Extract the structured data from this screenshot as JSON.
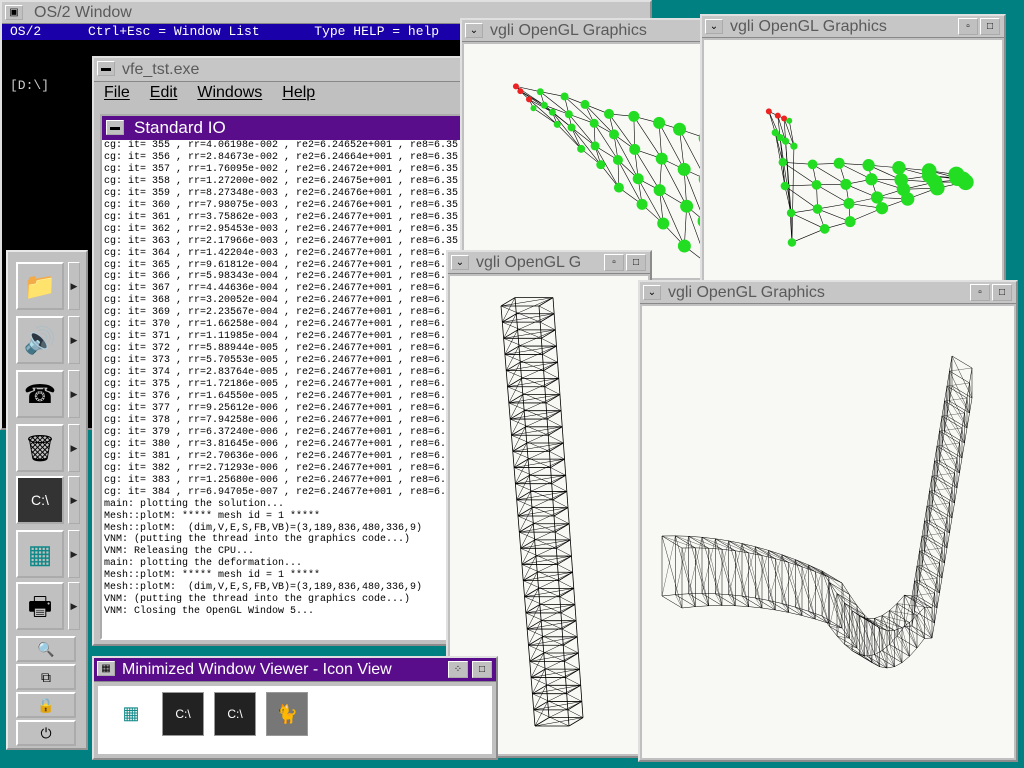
{
  "os2_window": {
    "title": "OS/2 Window",
    "status_left": "OS/2",
    "status_mid": "Ctrl+Esc = Window List",
    "status_right": "Type HELP = help",
    "prompt": "[D:\\]"
  },
  "vfe_window": {
    "title": "vfe_tst.exe",
    "menu": [
      "File",
      "Edit",
      "Windows",
      "Help"
    ],
    "stdio_title": "Standard IO",
    "lines": [
      "cg: it= 355 , rr=4.06198e-002 , re2=6.24652e+001 , re8=6.35!",
      "cg: it= 356 , rr=2.84673e-002 , re2=6.24664e+001 , re8=6.35!",
      "cg: it= 357 , rr=1.76095e-002 , re2=6.24672e+001 , re8=6.35!",
      "cg: it= 358 , rr=1.27200e-002 , re2=6.24675e+001 , re8=6.35!",
      "cg: it= 359 , rr=8.27348e-003 , re2=6.24676e+001 , re8=6.35!",
      "cg: it= 360 , rr=7.98075e-003 , re2=6.24676e+001 , re8=6.35!",
      "cg: it= 361 , rr=3.75862e-003 , re2=6.24677e+001 , re8=6.35!",
      "cg: it= 362 , rr=2.95453e-003 , re2=6.24677e+001 , re8=6.35!",
      "cg: it= 363 , rr=2.17966e-003 , re2=6.24677e+001 , re8=6.35!",
      "cg: it= 364 , rr=1.42204e-003 , re2=6.24677e+001 , re8=6.",
      "cg: it= 365 , rr=9.61812e-004 , re2=6.24677e+001 , re8=6.",
      "cg: it= 366 , rr=5.98343e-004 , re2=6.24677e+001 , re8=6.",
      "cg: it= 367 , rr=4.44636e-004 , re2=6.24677e+001 , re8=6.",
      "cg: it= 368 , rr=3.20052e-004 , re2=6.24677e+001 , re8=6.",
      "cg: it= 369 , rr=2.23567e-004 , re2=6.24677e+001 , re8=6.",
      "cg: it= 370 , rr=1.66258e-004 , re2=6.24677e+001 , re8=6.",
      "cg: it= 371 , rr=1.11985e-004 , re2=6.24677e+001 , re8=6.",
      "cg: it= 372 , rr=5.88944e-005 , re2=6.24677e+001 , re8=6.",
      "cg: it= 373 , rr=5.70553e-005 , re2=6.24677e+001 , re8=6.",
      "cg: it= 374 , rr=2.83764e-005 , re2=6.24677e+001 , re8=6.",
      "cg: it= 375 , rr=1.72186e-005 , re2=6.24677e+001 , re8=6.",
      "cg: it= 376 , rr=1.64550e-005 , re2=6.24677e+001 , re8=6.",
      "cg: it= 377 , rr=9.25612e-006 , re2=6.24677e+001 , re8=6.",
      "cg: it= 378 , rr=7.94258e-006 , re2=6.24677e+001 , re8=6.",
      "cg: it= 379 , rr=6.37240e-006 , re2=6.24677e+001 , re8=6.",
      "cg: it= 380 , rr=3.81645e-006 , re2=6.24677e+001 , re8=6.",
      "cg: it= 381 , rr=2.70636e-006 , re2=6.24677e+001 , re8=6.",
      "cg: it= 382 , rr=2.71293e-006 , re2=6.24677e+001 , re8=6.",
      "cg: it= 383 , rr=1.25680e-006 , re2=6.24677e+001 , re8=6.",
      "cg: it= 384 , rr=6.94705e-007 , re2=6.24677e+001 , re8=6.",
      "main: plotting the solution...",
      "Mesh::plotM: ***** mesh id = 1 *****",
      "Mesh::plotM:  (dim,V,E,S,FB,VB)=(3,189,836,480,336,9)",
      "VNM: (putting the thread into the graphics code...)",
      "VNM: Releasing the CPU...",
      "main: plotting the deformation...",
      "Mesh::plotM: ***** mesh id = 1 *****",
      "Mesh::plotM:  (dim,V,E,S,FB,VB)=(3,189,836,480,336,9)",
      "VNM: (putting the thread into the graphics code...)",
      "VNM: Closing the OpenGL Window 5..."
    ]
  },
  "gfx_windows": [
    {
      "title": "vgli OpenGL Graphics"
    },
    {
      "title": "vgli OpenGL Graphics"
    },
    {
      "title": "vgli OpenGL G"
    },
    {
      "title": "vgli OpenGL Graphics"
    }
  ],
  "mwv": {
    "title": "Minimized Window Viewer - Icon View"
  },
  "colors": {
    "desktop": "#008080",
    "active_title": "#5a0d8a",
    "node_green": "#22dd22",
    "node_red": "#ee2222"
  }
}
